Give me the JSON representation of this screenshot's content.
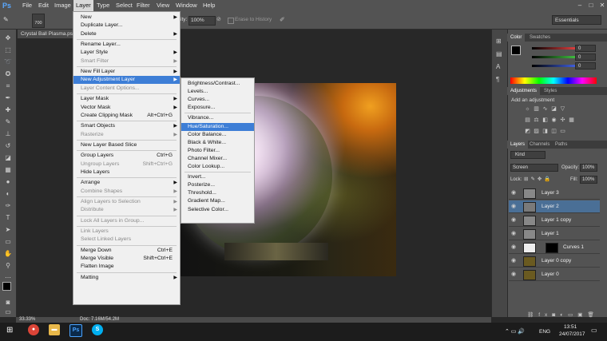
{
  "app": {
    "logo": "Ps"
  },
  "menubar": {
    "items": [
      "File",
      "Edit",
      "Image",
      "Layer",
      "Type",
      "Select",
      "Filter",
      "View",
      "Window",
      "Help"
    ],
    "active": "Layer",
    "window_controls": [
      "–",
      "□",
      "✕"
    ]
  },
  "options_bar": {
    "brush_size": "700",
    "opacity_label": "ity:",
    "opacity_value": "100%",
    "erase_to_history": "Erase to History",
    "workspace": "Essentials"
  },
  "document": {
    "tab_title": "Crystal Ball Plasma.ps"
  },
  "layer_menu": {
    "items": [
      {
        "label": "New",
        "arrow": true
      },
      {
        "label": "Duplicate Layer..."
      },
      {
        "label": "Delete",
        "arrow": true
      },
      {
        "sep": true
      },
      {
        "label": "Rename Layer..."
      },
      {
        "label": "Layer Style",
        "arrow": true
      },
      {
        "label": "Smart Filter",
        "disabled": true,
        "arrow": true
      },
      {
        "sep": true
      },
      {
        "label": "New Fill Layer",
        "arrow": true
      },
      {
        "label": "New Adjustment Layer",
        "arrow": true,
        "highlighted": true
      },
      {
        "label": "Layer Content Options...",
        "disabled": true
      },
      {
        "sep": true
      },
      {
        "label": "Layer Mask",
        "arrow": true
      },
      {
        "label": "Vector Mask",
        "arrow": true
      },
      {
        "label": "Create Clipping Mask",
        "shortcut": "Alt+Ctrl+G"
      },
      {
        "sep": true
      },
      {
        "label": "Smart Objects",
        "arrow": true
      },
      {
        "label": "Rasterize",
        "disabled": true,
        "arrow": true
      },
      {
        "sep": true
      },
      {
        "label": "New Layer Based Slice"
      },
      {
        "sep": true
      },
      {
        "label": "Group Layers",
        "shortcut": "Ctrl+G"
      },
      {
        "label": "Ungroup Layers",
        "shortcut": "Shift+Ctrl+G",
        "disabled": true
      },
      {
        "label": "Hide Layers"
      },
      {
        "sep": true
      },
      {
        "label": "Arrange",
        "arrow": true
      },
      {
        "label": "Combine Shapes",
        "disabled": true,
        "arrow": true
      },
      {
        "sep": true
      },
      {
        "label": "Align Layers to Selection",
        "disabled": true,
        "arrow": true
      },
      {
        "label": "Distribute",
        "disabled": true,
        "arrow": true
      },
      {
        "sep": true
      },
      {
        "label": "Lock All Layers in Group...",
        "disabled": true
      },
      {
        "sep": true
      },
      {
        "label": "Link Layers",
        "disabled": true
      },
      {
        "label": "Select Linked Layers",
        "disabled": true
      },
      {
        "sep": true
      },
      {
        "label": "Merge Down",
        "shortcut": "Ctrl+E"
      },
      {
        "label": "Merge Visible",
        "shortcut": "Shift+Ctrl+E"
      },
      {
        "label": "Flatten Image"
      },
      {
        "sep": true
      },
      {
        "label": "Matting",
        "arrow": true
      }
    ]
  },
  "adjustment_submenu": {
    "items": [
      {
        "label": "Brightness/Contrast..."
      },
      {
        "label": "Levels..."
      },
      {
        "label": "Curves..."
      },
      {
        "label": "Exposure..."
      },
      {
        "sep": true
      },
      {
        "label": "Vibrance..."
      },
      {
        "label": "Hue/Saturation...",
        "highlighted": true
      },
      {
        "label": "Color Balance..."
      },
      {
        "label": "Black & White..."
      },
      {
        "label": "Photo Filter..."
      },
      {
        "label": "Channel Mixer..."
      },
      {
        "label": "Color Lookup..."
      },
      {
        "sep": true
      },
      {
        "label": "Invert..."
      },
      {
        "label": "Posterize..."
      },
      {
        "label": "Threshold..."
      },
      {
        "label": "Gradient Map..."
      },
      {
        "label": "Selective Color..."
      }
    ]
  },
  "color_panel": {
    "tabs": [
      "Color",
      "Swatches"
    ],
    "channels": [
      {
        "label": "R",
        "value": "0",
        "color": "#e04040"
      },
      {
        "label": "G",
        "value": "0",
        "color": "#40c040"
      },
      {
        "label": "B",
        "value": "0",
        "color": "#4060e0"
      }
    ]
  },
  "adjustments_panel": {
    "tabs": [
      "Adjustments",
      "Styles"
    ],
    "heading": "Add an adjustment"
  },
  "layers_panel": {
    "tabs": [
      "Layers",
      "Channels",
      "Paths"
    ],
    "kind_label": "Kind",
    "blend_mode": "Screen",
    "opacity_label": "Opacity:",
    "opacity_value": "100%",
    "lock_label": "Lock:",
    "fill_label": "Fill:",
    "fill_value": "100%",
    "layers": [
      {
        "name": "Layer 3",
        "selected": false
      },
      {
        "name": "Layer 2",
        "selected": true
      },
      {
        "name": "Layer 1 copy",
        "selected": false
      },
      {
        "name": "Layer 1",
        "selected": false
      },
      {
        "name": "Curves 1",
        "selected": false
      },
      {
        "name": "Layer 0 copy",
        "selected": false
      },
      {
        "name": "Layer 0",
        "selected": false
      }
    ]
  },
  "status_bar": {
    "zoom": "33.33%",
    "doc": "Doc: 7.16M/54.2M"
  },
  "taskbar": {
    "language": "ENG",
    "time": "13:51",
    "date": "24/07/2017"
  }
}
